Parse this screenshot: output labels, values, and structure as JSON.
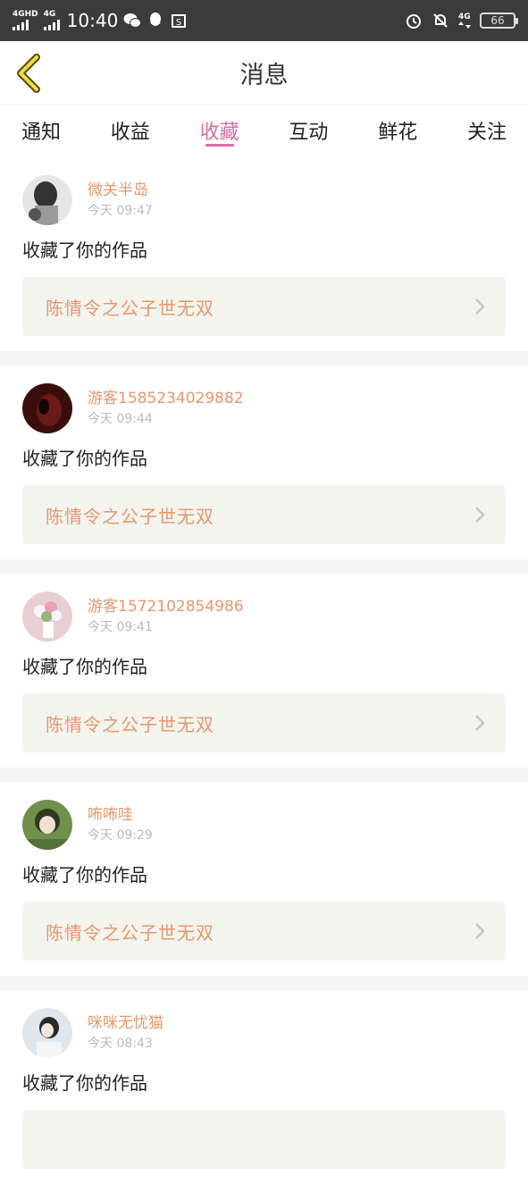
{
  "status_bar": {
    "net1": "4GHD",
    "net2": "4G",
    "time": "10:40",
    "net3": "4G",
    "battery": "66"
  },
  "header": {
    "title": "消息"
  },
  "tabs": [
    {
      "label": "通知"
    },
    {
      "label": "收益"
    },
    {
      "label": "收藏",
      "active": true
    },
    {
      "label": "互动"
    },
    {
      "label": "鲜花"
    },
    {
      "label": "关注"
    }
  ],
  "colors": {
    "accent_pink": "#e06aa6",
    "name_orange": "#e8976a",
    "card_bg": "#f4f4ee"
  },
  "items": [
    {
      "name": "微关半岛",
      "time": "今天 09:47",
      "action": "收藏了你的作品",
      "work": "陈情令之公子世无双"
    },
    {
      "name": "游客1585234029882",
      "time": "今天 09:44",
      "action": "收藏了你的作品",
      "work": "陈情令之公子世无双"
    },
    {
      "name": "游客1572102854986",
      "time": "今天 09:41",
      "action": "收藏了你的作品",
      "work": "陈情令之公子世无双"
    },
    {
      "name": "咘咘哇",
      "time": "今天 09:29",
      "action": "收藏了你的作品",
      "work": "陈情令之公子世无双"
    },
    {
      "name": "咪咪无忧猫",
      "time": "今天 08:43",
      "action": "收藏了你的作品",
      "work": ""
    }
  ]
}
